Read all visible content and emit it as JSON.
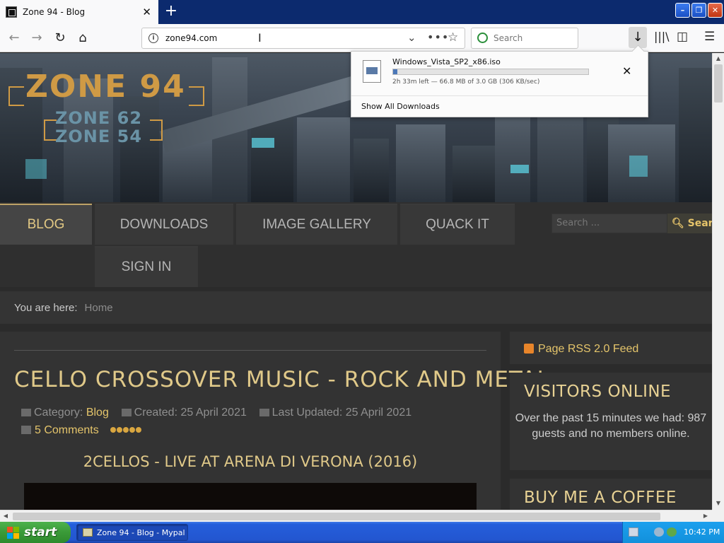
{
  "browser": {
    "tab": {
      "title": "Zone 94 - Blog"
    },
    "url": "zone94.com",
    "search_placeholder": "Search"
  },
  "download": {
    "filename": "Windows_Vista_SP2_x86.iso",
    "progress": 0.022,
    "status": "2h 33m left — 66.8 MB of 3.0 GB (306 KB/sec)",
    "show_all": "Show All Downloads"
  },
  "site": {
    "logo": {
      "main": "ZONE 94",
      "sub1": "ZONE 62",
      "sub2": "ZONE 54"
    },
    "menu": {
      "blog": "BLOG",
      "downloads": "DOWNLOADS",
      "gallery": "IMAGE GALLERY",
      "quack": "QUACK IT",
      "signin": "SIGN IN"
    },
    "search": {
      "placeholder": "Search ...",
      "button": "Search"
    },
    "breadcrumb": {
      "label": "You are here:",
      "home": "Home"
    },
    "article": {
      "title": "CELLO CROSSOVER MUSIC - ROCK AND METAL",
      "category_label": "Category:",
      "category": "Blog",
      "created": "Created: 25 April 2021",
      "updated": "Last Updated: 25 April 2021",
      "comments": "5 Comments",
      "subheading": "2CELLOS - LIVE AT ARENA DI VERONA (2016)"
    },
    "sidebar": {
      "rss": "Page RSS 2.0 Feed",
      "visitors_title": "VISITORS ONLINE",
      "visitors_text": "Over the past 15 minutes we had: 987 guests and no members online.",
      "coffee_title": "BUY ME A COFFEE"
    }
  },
  "taskbar": {
    "start": "start",
    "task": "Zone 94 - Blog - Mypal",
    "clock": "10:42 PM"
  },
  "colors": {
    "accent": "#e5c56b",
    "title_gold": "#e0c989",
    "xp_blue": "#245edb",
    "xp_green": "#3a9a38"
  }
}
